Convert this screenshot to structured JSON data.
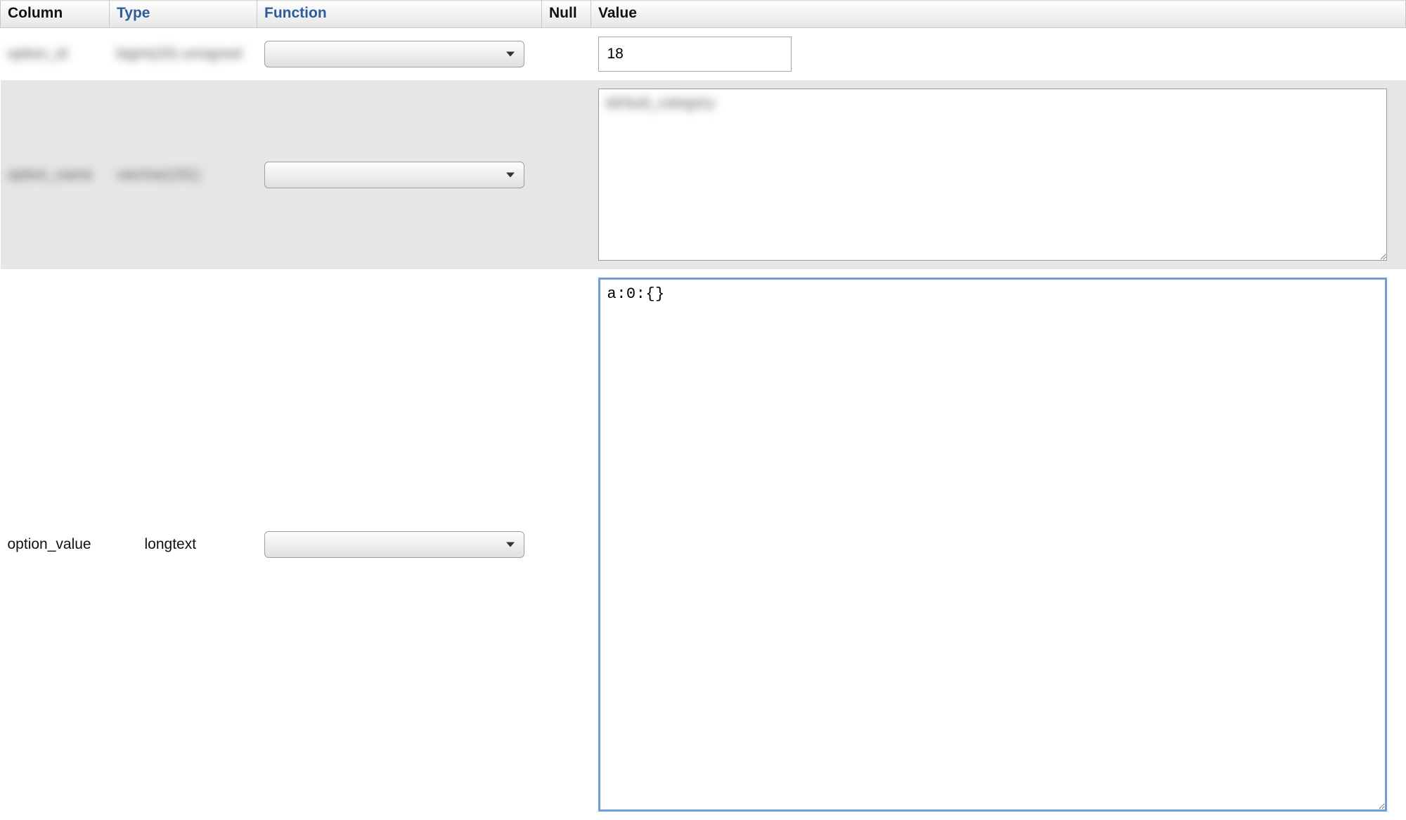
{
  "headers": {
    "column": "Column",
    "type": "Type",
    "function": "Function",
    "null": "Null",
    "value": "Value"
  },
  "rows": [
    {
      "column": "option_id",
      "type": "bigint(20) unsigned",
      "column_blurred": true,
      "type_blurred": true,
      "function": "",
      "null": null,
      "value_kind": "input",
      "value": "18"
    },
    {
      "column": "option_name",
      "type": "varchar(191)",
      "column_blurred": true,
      "type_blurred": true,
      "function": "",
      "null": null,
      "value_kind": "textarea",
      "value": "default_category",
      "value_blurred": true,
      "textarea_height": 245
    },
    {
      "column": "option_value",
      "type": "longtext",
      "column_blurred": false,
      "type_blurred": false,
      "function": "",
      "null": null,
      "value_kind": "textarea_mono_focused",
      "value": "a:0:{}",
      "textarea_height": 760
    }
  ]
}
